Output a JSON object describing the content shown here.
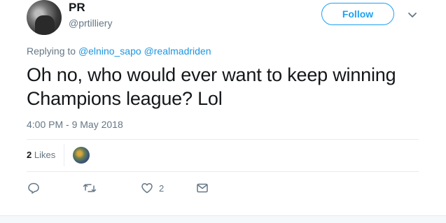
{
  "author": {
    "display_name": "PR",
    "handle": "@prtilliery"
  },
  "follow_button": {
    "label": "Follow"
  },
  "reply_context": {
    "prefix": "Replying to",
    "mentions": [
      "@elnino_sapo",
      "@realmadriden"
    ]
  },
  "tweet": {
    "text_line1": "Oh no, who would ever want to keep winning",
    "text_line2": "Champions league? Lol",
    "timestamp": "4:00 PM - 9 May 2018"
  },
  "stats": {
    "likes_count": "2",
    "likes_label": "Likes"
  },
  "actions": {
    "reply_icon": "reply-icon",
    "retweet_icon": "retweet-icon",
    "like_icon": "heart-icon",
    "like_count": "2",
    "dm_icon": "envelope-icon"
  },
  "colors": {
    "accent": "#1da1f2",
    "link": "#1b95e0",
    "muted": "#657786",
    "text": "#14171a"
  }
}
